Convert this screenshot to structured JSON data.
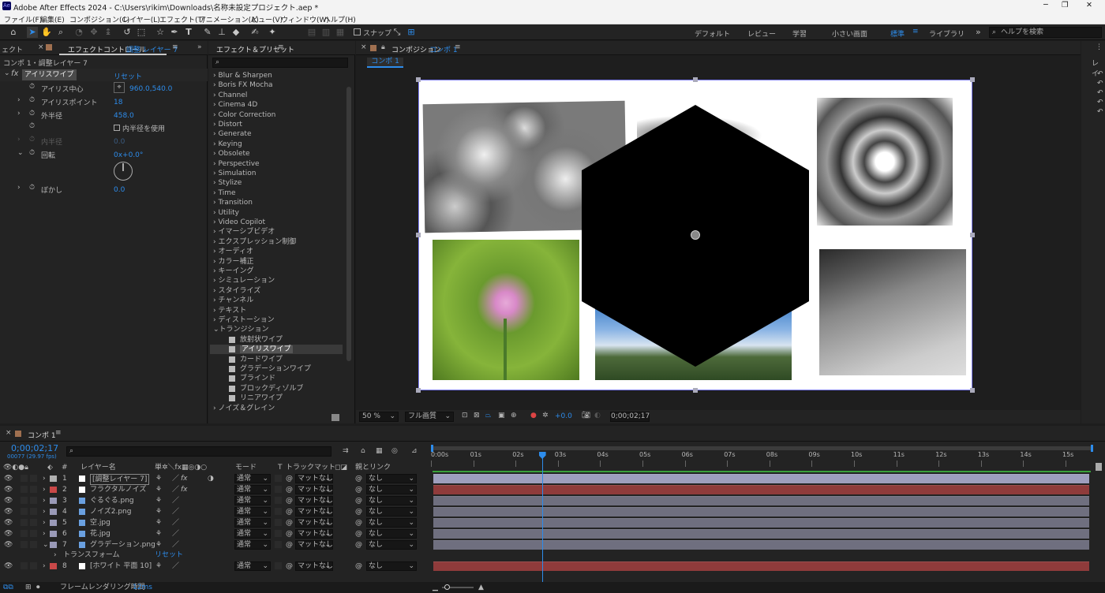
{
  "titlebar": {
    "app_badge": "Ae",
    "title": "Adobe After Effects 2024 - C:\\Users\\rikim\\Downloads\\名称未設定プロジェクト.aep *",
    "minimize": "─",
    "maximize": "❐",
    "close": "✕"
  },
  "menu": [
    "ファイル(F)",
    "編集(E)",
    "コンポジション(C)",
    "レイヤー(L)",
    "エフェクト(T)",
    "アニメーション(A)",
    "ビュー(V)",
    "ウィンドウ(W)",
    "ヘルプ(H)"
  ],
  "toolbar": {
    "snap_label": "スナップ",
    "workspaces": [
      "デフォルト",
      "レビュー",
      "学習",
      "小さい画面",
      "標準",
      "ライブラリ"
    ],
    "active_workspace": "標準",
    "more": "»",
    "help_placeholder": "ヘルプを検索"
  },
  "effect_controls": {
    "tab_left": "ェクト",
    "tab_label": "エフェクトコントロール",
    "tab_layer": "調整 レイヤー 7",
    "breadcrumb": "コンポ 1・調整レイヤー 7",
    "effect_name": "アイリスワイプ",
    "reset": "リセット",
    "props": [
      {
        "label": "アイリス中心",
        "value": "960.0,540.0"
      },
      {
        "label": "アイリスポイント",
        "value": "18"
      },
      {
        "label": "外半径",
        "value": "458.0"
      },
      {
        "label": "",
        "value": "内半径を使用"
      },
      {
        "label": "内半径",
        "value": "0.0"
      },
      {
        "label": "回転",
        "value": "0x+0.0°"
      },
      {
        "label": "ぼかし",
        "value": "0.0"
      }
    ]
  },
  "effects_presets": {
    "title": "エフェクト＆プリセット",
    "search_placeholder": "",
    "categories": [
      "Blur & Sharpen",
      "Boris FX Mocha",
      "Channel",
      "Cinema 4D",
      "Color Correction",
      "Distort",
      "Generate",
      "Keying",
      "Obsolete",
      "Perspective",
      "Simulation",
      "Stylize",
      "Time",
      "Transition",
      "Utility",
      "Video Copilot",
      "イマーシブビデオ",
      "エクスプレッション制御",
      "オーディオ",
      "カラー補正",
      "キーイング",
      "シミュレーション",
      "スタイライズ",
      "チャンネル",
      "テキスト",
      "ディストーション"
    ],
    "open_category": "トランジション",
    "transitions": [
      "放射状ワイプ",
      "アイリスワイプ",
      "カードワイプ",
      "グラデーションワイプ",
      "ブラインド",
      "ブロックディゾルブ",
      "リニアワイプ"
    ],
    "selected": "アイリスワイプ",
    "last_category": "ノイズ＆グレイン"
  },
  "composition": {
    "tab_label": "コンポジション",
    "comp_name": "コンポ 1",
    "subtab": "コンポ 1",
    "zoom": "50 %",
    "resolution": "フル画質",
    "exposure": "+0.0",
    "timecode": "0;00;02;17"
  },
  "right_panel": {
    "label": "レイ"
  },
  "timeline": {
    "tab": "コンポ 1",
    "timecode": "0;00;02;17",
    "frame_info": "00077 (29.97 fps)",
    "search_placeholder": "",
    "headers": {
      "num": "#",
      "layer_name": "レイヤー名",
      "switches": "単✲＼fx▦◎◑○",
      "mode": "モード",
      "t": "T",
      "trackmatte": "トラックマット",
      "parent": "親とリンク"
    },
    "layers": [
      {
        "num": "1",
        "name": "[調整レイヤー 7]",
        "color": "#b0b0b0",
        "mode": "通常",
        "matte": "マットなし",
        "parent": "なし",
        "fx": true
      },
      {
        "num": "2",
        "name": "フラクタルノイズ",
        "color": "#c94848",
        "mode": "通常",
        "matte": "マットなし",
        "parent": "なし",
        "fx": true
      },
      {
        "num": "3",
        "name": "ぐるぐる.png",
        "color": "#9a9ab8",
        "mode": "通常",
        "matte": "マットなし",
        "parent": "なし",
        "fx": false
      },
      {
        "num": "4",
        "name": "ノイズ2.png",
        "color": "#9a9ab8",
        "mode": "通常",
        "matte": "マットなし",
        "parent": "なし",
        "fx": false
      },
      {
        "num": "5",
        "name": "空.jpg",
        "color": "#9a9ab8",
        "mode": "通常",
        "matte": "マットなし",
        "parent": "なし",
        "fx": false
      },
      {
        "num": "6",
        "name": "花.jpg",
        "color": "#9a9ab8",
        "mode": "通常",
        "matte": "マットなし",
        "parent": "なし",
        "fx": false
      },
      {
        "num": "7",
        "name": "グラデーション.png",
        "color": "#9a9ab8",
        "mode": "通常",
        "matte": "マットなし",
        "parent": "なし",
        "fx": false
      },
      {
        "num": "8",
        "name": "[ホワイト 平面 10]",
        "color": "#c94848",
        "mode": "通常",
        "matte": "マットなし",
        "parent": "なし",
        "fx": false
      }
    ],
    "transform": "トランスフォーム",
    "transform_reset": "リセット",
    "ruler": [
      "0:00s",
      "01s",
      "02s",
      "03s",
      "04s",
      "05s",
      "06s",
      "07s",
      "08s",
      "09s",
      "10s",
      "11s",
      "12s",
      "13s",
      "14s",
      "15s"
    ],
    "playhead_fraction": 0.172,
    "render_label": "フレームレンダリング時間",
    "render_time": "12ms"
  },
  "colors": {
    "accent": "#2d8ceb",
    "bg": "#1d1d1d",
    "panel": "#232323",
    "track_adjust": "#9e9ebd",
    "track_red": "#8f3b3b",
    "track_gray": "#6f6f7f"
  }
}
